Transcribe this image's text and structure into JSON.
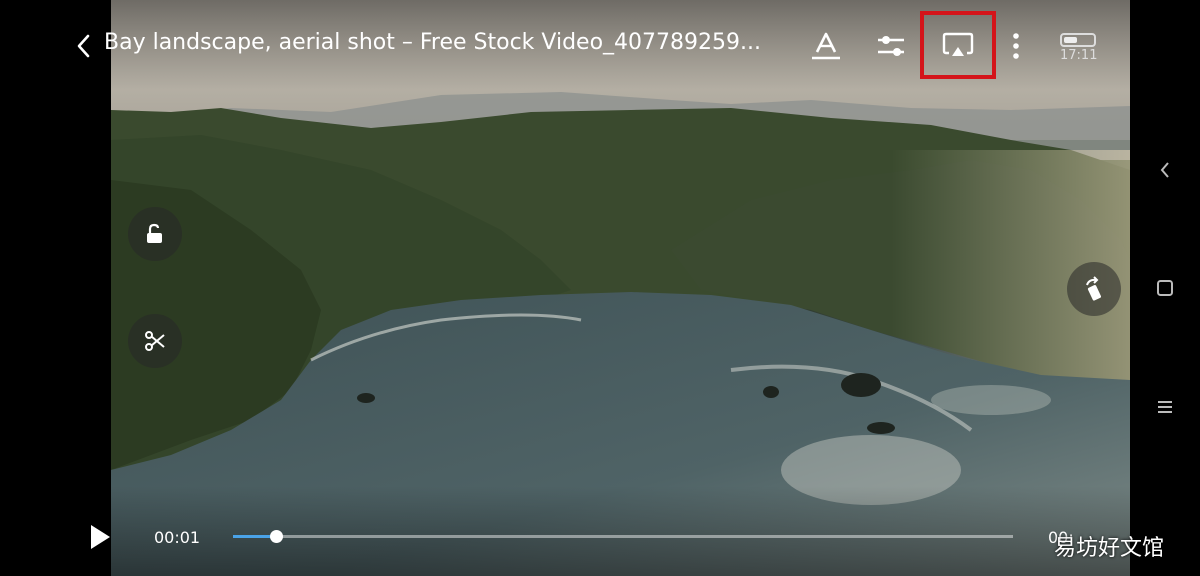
{
  "header": {
    "title": "Bay landscape, aerial shot – Free Stock Video_407789259...",
    "status_time": "17:11",
    "battery_level": 0.45
  },
  "icons": {
    "back": "chevron-left-icon",
    "subtitle": "text-format-icon",
    "settings": "sliders-icon",
    "cast": "screen-cast-icon",
    "more": "more-vertical-icon",
    "lock": "unlock-icon",
    "clip": "scissors-icon",
    "rotate": "rotate-icon"
  },
  "highlight_color": "#d4141a",
  "player": {
    "current_time": "00:01",
    "total_time": "00:",
    "progress": 0.055,
    "progress_color": "#4aa3e8"
  },
  "watermark": "易坊好文馆"
}
